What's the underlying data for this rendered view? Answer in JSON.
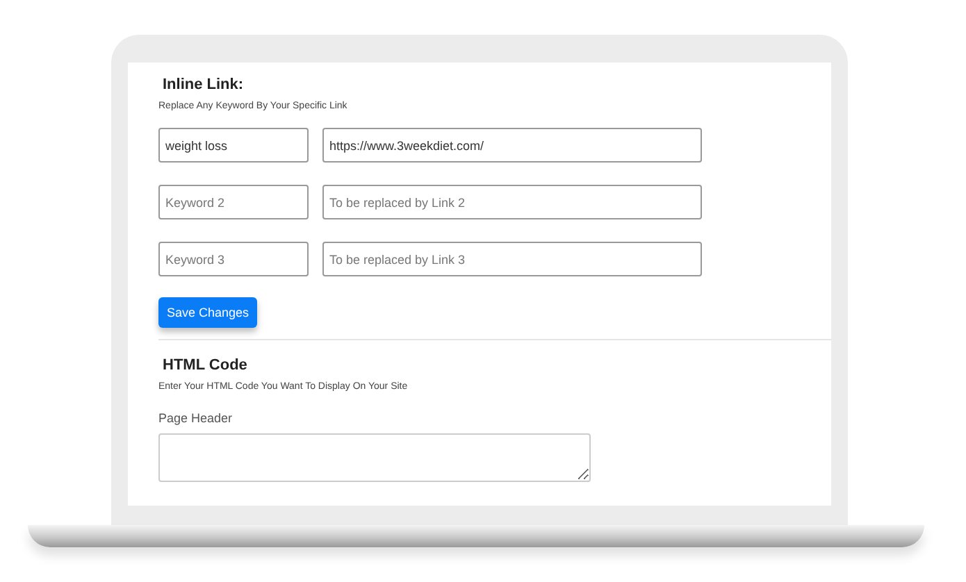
{
  "inline_link": {
    "title": "Inline Link:",
    "description": "Replace Any Keyword By Your Specific Link",
    "rows": [
      {
        "keyword": {
          "value": "weight loss"
        },
        "link": {
          "value": "https://www.3weekdiet.com/"
        }
      },
      {
        "keyword": {
          "placeholder": "Keyword 2"
        },
        "link": {
          "placeholder": "To be replaced by Link 2"
        }
      },
      {
        "keyword": {
          "placeholder": "Keyword 3"
        },
        "link": {
          "placeholder": "To be replaced by Link 3"
        }
      }
    ],
    "save_button": "Save Changes"
  },
  "html_code": {
    "title": "HTML Code",
    "description": "Enter Your HTML Code You Want To Display On Your Site",
    "field_label": "Page Header"
  }
}
